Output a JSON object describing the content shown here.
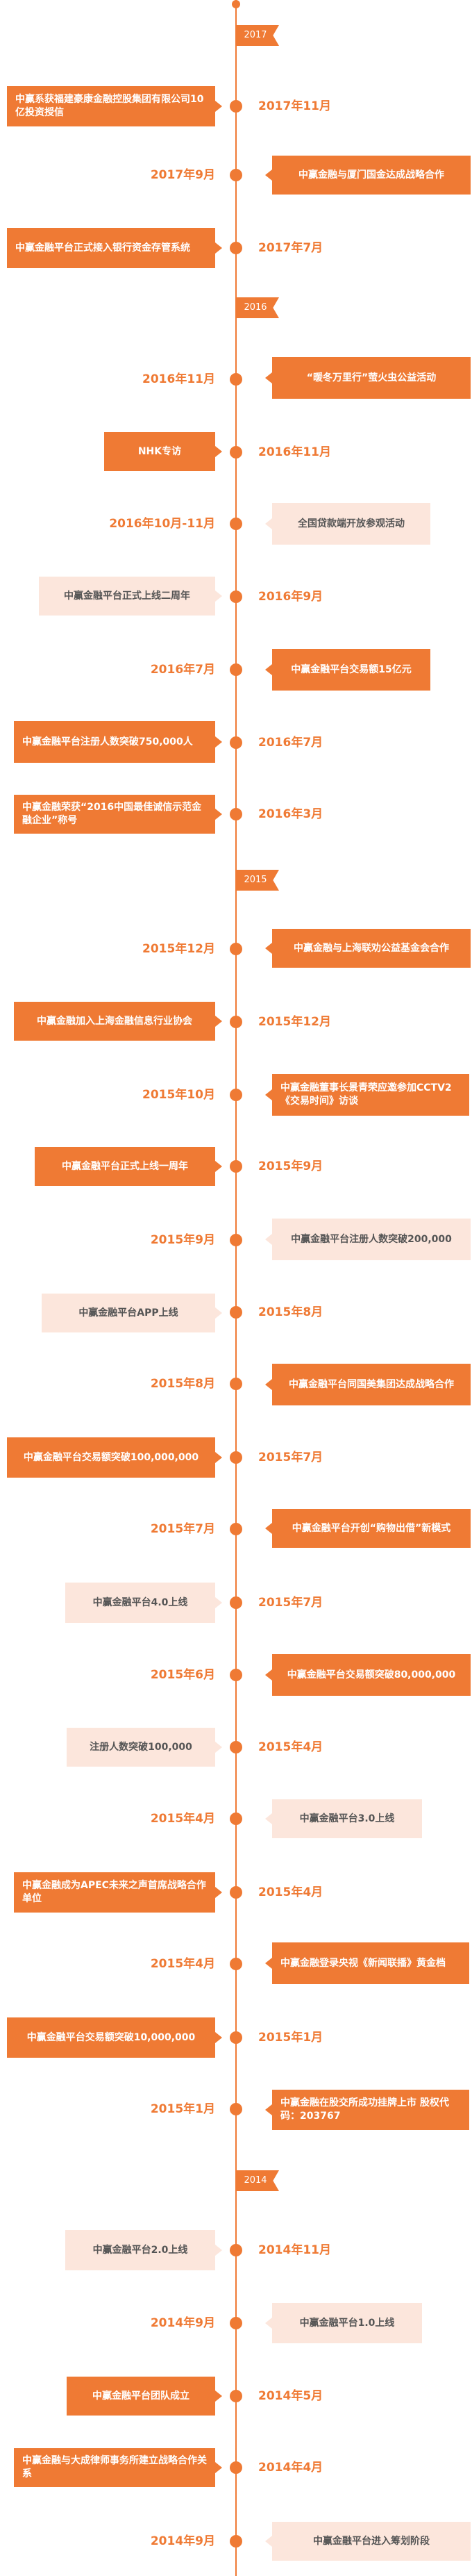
{
  "years": [
    "2017",
    "2016",
    "2015",
    "2014"
  ],
  "events": [
    {
      "date": "2017年11月",
      "text": "中赢系获福建豪康金融控股集团有限公司10亿投资授信"
    },
    {
      "date": "2017年9月",
      "text": "中赢金融与厦门国金达成战略合作"
    },
    {
      "date": "2017年7月",
      "text": "中赢金融平台正式接入银行资金存管系统"
    },
    {
      "date": "2016年11月",
      "text": "“暖冬万里行”萤火虫公益活动"
    },
    {
      "date": "2016年11月",
      "text": "NHK专访"
    },
    {
      "date": "2016年10月-11月",
      "text": "全国贷款端开放参观活动"
    },
    {
      "date": "2016年9月",
      "text": "中赢金融平台正式上线二周年"
    },
    {
      "date": "2016年7月",
      "text": "中赢金融平台交易额15亿元"
    },
    {
      "date": "2016年7月",
      "text": "中赢金融平台注册人数突破750,000人"
    },
    {
      "date": "2016年3月",
      "text": "中赢金融荣获“2016中国最佳诚信示范金融企业”称号"
    },
    {
      "date": "2015年12月",
      "text": "中赢金融与上海联劝公益基金会合作"
    },
    {
      "date": "2015年12月",
      "text": "中赢金融加入上海金融信息行业协会"
    },
    {
      "date": "2015年10月",
      "text": "中赢金融董事长景青荣应邀参加CCTV2《交易时间》访谈"
    },
    {
      "date": "2015年9月",
      "text": "中赢金融平台正式上线一周年"
    },
    {
      "date": "2015年9月",
      "text": "中赢金融平台注册人数突破200,000"
    },
    {
      "date": "2015年8月",
      "text": "中赢金融平台APP上线"
    },
    {
      "date": "2015年8月",
      "text": "中赢金融平台同国美集团达成战略合作"
    },
    {
      "date": "2015年7月",
      "text": "中赢金融平台交易额突破100,000,000"
    },
    {
      "date": "2015年7月",
      "text": "中赢金融平台开创“购物出借”新模式"
    },
    {
      "date": "2015年7月",
      "text": "中赢金融平台4.0上线"
    },
    {
      "date": "2015年6月",
      "text": "中赢金融平台交易额突破80,000,000"
    },
    {
      "date": "2015年4月",
      "text": "注册人数突破100,000"
    },
    {
      "date": "2015年4月",
      "text": "中赢金融平台3.0上线"
    },
    {
      "date": "2015年4月",
      "text": "中赢金融成为APEC未来之声首席战略合作单位"
    },
    {
      "date": "2015年4月",
      "text": "中赢金融登录央视《新闻联播》黄金档"
    },
    {
      "date": "2015年1月",
      "text": "中赢金融平台交易额突破10,000,000"
    },
    {
      "date": "2015年1月",
      "text": "中赢金融在股交所成功挂牌上市 股权代码：203767"
    },
    {
      "date": "2014年11月",
      "text": "中赢金融平台2.0上线"
    },
    {
      "date": "2014年9月",
      "text": "中赢金融平台1.0上线"
    },
    {
      "date": "2014年5月",
      "text": "中赢金融平台团队成立"
    },
    {
      "date": "2014年4月",
      "text": "中赢金融与大成律师事务所建立战略合作关系"
    },
    {
      "date": "2014年9月",
      "text": "中赢金融平台进入筹划阶段"
    }
  ],
  "colors": {
    "accent": "#ef7a34",
    "light_card": "#fce6dc",
    "light_text": "#555555"
  }
}
